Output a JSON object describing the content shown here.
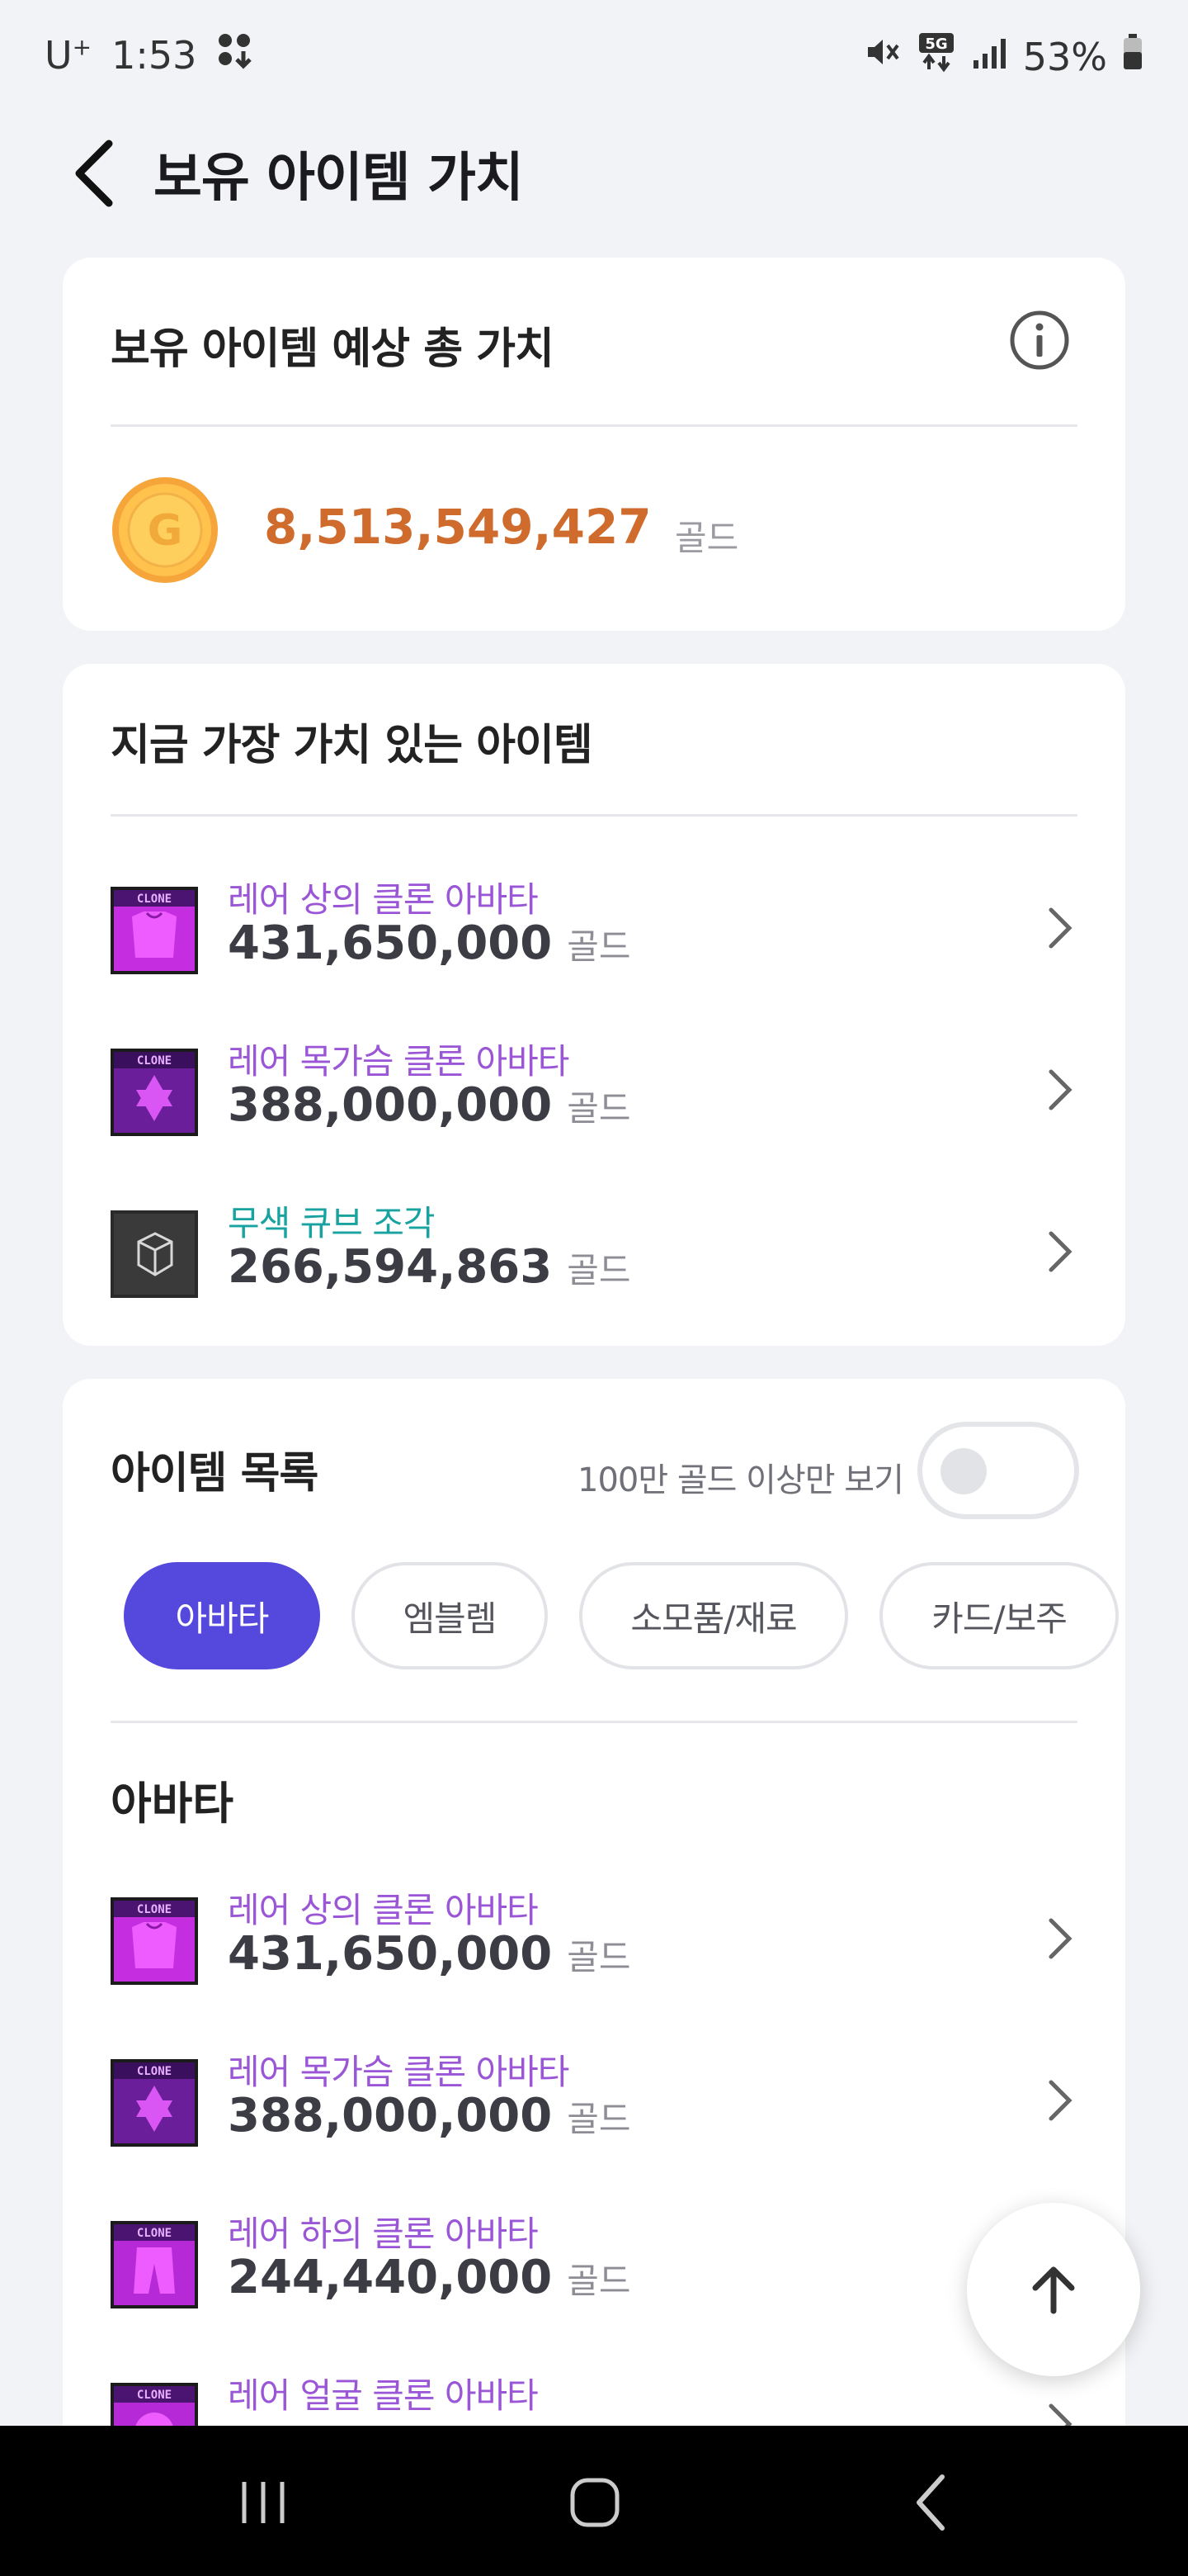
{
  "status_bar": {
    "carrier": "U",
    "carrier_sup": "+",
    "time": "1:53",
    "network": "5G",
    "battery": "53%"
  },
  "header": {
    "title": "보유 아이템 가치"
  },
  "total_card": {
    "title": "보유 아이템 예상 총 가치",
    "coin_letter": "G",
    "value": "8,513,549,427",
    "unit": "골드"
  },
  "top_items": {
    "title": "지금 가장 가치 있는 아이템",
    "items": [
      {
        "name": "레어 상의 클론 아바타",
        "price": "431,650,000",
        "unit": "골드",
        "name_color": "#9a56d6"
      },
      {
        "name": "레어 목가슴 클론 아바타",
        "price": "388,000,000",
        "unit": "골드",
        "name_color": "#9a56d6"
      },
      {
        "name": "무색 큐브 조각",
        "price": "266,594,863",
        "unit": "골드",
        "name_color": "#18a3a0"
      }
    ]
  },
  "item_list": {
    "title": "아이템 목록",
    "toggle_label": "100만 골드 이상만 보기",
    "toggle_on": false,
    "tabs": [
      {
        "label": "아바타",
        "active": true
      },
      {
        "label": "엠블렘",
        "active": false
      },
      {
        "label": "소모품/재료",
        "active": false
      },
      {
        "label": "카드/보주",
        "active": false
      }
    ],
    "section": "아바타",
    "items": [
      {
        "name": "레어 상의 클론 아바타",
        "price": "431,650,000",
        "unit": "골드"
      },
      {
        "name": "레어 목가슴 클론 아바타",
        "price": "388,000,000",
        "unit": "골드"
      },
      {
        "name": "레어 하의 클론 아바타",
        "price": "244,440,000",
        "unit": "골드"
      },
      {
        "name": "레어 얼굴 클론 아바타",
        "price": "",
        "unit": ""
      }
    ]
  },
  "colors": {
    "accent": "#5548dd",
    "gold_value": "#cf6b2c",
    "rare_purple": "#9a56d6",
    "teal": "#18a3a0"
  }
}
